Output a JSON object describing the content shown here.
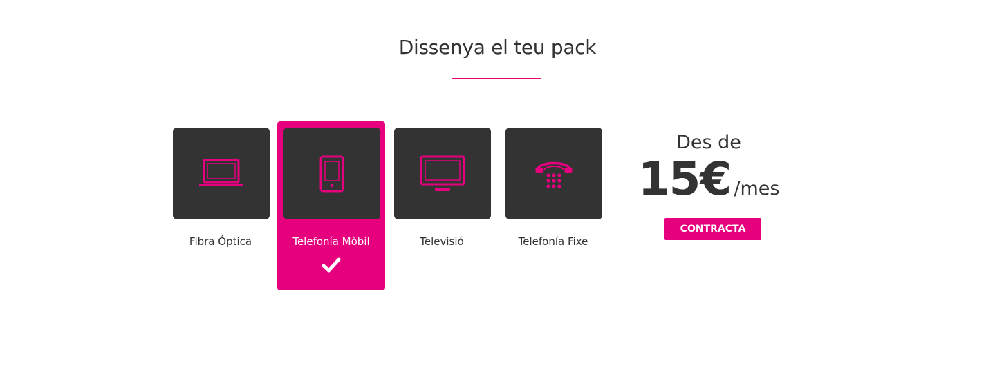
{
  "section": {
    "title": "Dissenya el teu pack"
  },
  "options": [
    {
      "label": "Fibra Óptica",
      "icon": "laptop-icon",
      "selected": false
    },
    {
      "label": "Telefonía Mòbil",
      "icon": "mobile-phone-icon",
      "selected": true
    },
    {
      "label": "Televisió",
      "icon": "tv-icon",
      "selected": false
    },
    {
      "label": "Telefonía Fixe",
      "icon": "landline-phone-icon",
      "selected": false
    }
  ],
  "price": {
    "prefix": "Des de",
    "amount": "15€",
    "unit": "/mes"
  },
  "cta": {
    "label": "CONTRACTA"
  },
  "colors": {
    "accent": "#e6007e",
    "tile": "#333333",
    "text": "#333333",
    "background": "#ffffff"
  }
}
